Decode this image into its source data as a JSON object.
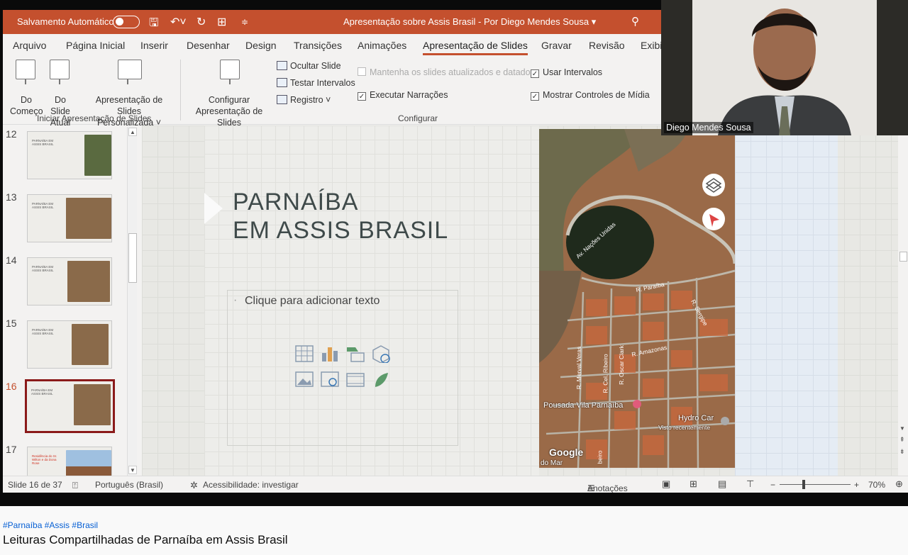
{
  "titlebar": {
    "autosave_label": "Salvamento Automático",
    "document_title": "Apresentação sobre Assis Brasil - Por Diego Mendes Sousa",
    "title_chevron": "▾"
  },
  "tabs": [
    "Arquivo",
    "Página Inicial",
    "Inserir",
    "Desenhar",
    "Design",
    "Transições",
    "Animações",
    "Apresentação de Slides",
    "Gravar",
    "Revisão",
    "Exibi"
  ],
  "active_tab": "Apresentação de Slides",
  "ribbon": {
    "from_beginning": "Do\nComeço",
    "from_current": "Do Slide\nAtual",
    "custom_show": "Apresentação de Slides\nPersonalizada ˅",
    "group_start_label": "Iniciar Apresentação de Slides",
    "setup_show": "Configurar\nApresentação de Slides",
    "hide_slide": "Ocultar Slide",
    "rehearse_timings": "Testar Intervalos",
    "record": "Registro  ˅",
    "keep_updated": "Mantenha os slides atualizados e datados",
    "play_narrations": "Executar Narrações",
    "use_timings": "Usar Intervalos",
    "show_media_controls": "Mostrar Controles de Mídia",
    "group_setup_label": "Configurar",
    "checks": {
      "keep_updated": false,
      "play_narrations": true,
      "use_timings": true,
      "show_media_controls": true
    }
  },
  "thumbnails": [
    {
      "num": "12",
      "text": "PARNAÍBA EM ASSIS BRASIL",
      "active": false
    },
    {
      "num": "13",
      "text": "PARNAÍBA EM ASSIS BRASIL",
      "active": false
    },
    {
      "num": "14",
      "text": "PARNAÍBA EM ASSIS BRASIL",
      "active": false
    },
    {
      "num": "15",
      "text": "PARNAÍBA EM ASSIS BRASIL",
      "active": false
    },
    {
      "num": "16",
      "text": "PARNAÍBA EM ASSIS BRASIL",
      "active": true
    },
    {
      "num": "17",
      "text": "Residência do Sr. Wilton e da Dona Rose",
      "active": false
    }
  ],
  "slide": {
    "title": "PARNAÍBA\nEM ASSIS BRASIL",
    "placeholder": "Clique para adicionar texto"
  },
  "map": {
    "labels": [
      "Av. Nações Unidas",
      "R. Paraíba",
      "R. Sergipe",
      "R. Amazonas",
      "R. Cel. Ribeiro",
      "R. Oscar Clark",
      "R. Merval Veras",
      "Pousada Vila Parnaíba",
      "Hydro Car",
      "Visto recentemente",
      "Google",
      "do Mar",
      "beiro"
    ]
  },
  "statusbar": {
    "slide_info": "Slide 16 de 37",
    "language": "Português (Brasil)",
    "accessibility": "Acessibilidade: investigar",
    "notes": "Anotações",
    "zoom": "70%"
  },
  "webcam": {
    "name": "Diego Mendes Sousa"
  },
  "video_info": {
    "hashtags": "#Parnaíba #Assis #Brasil",
    "title": "Leituras Compartilhadas de Parnaíba em Assis Brasil"
  },
  "colors": {
    "accent": "#c4502e",
    "active_thumb": "#8b1a1a"
  }
}
